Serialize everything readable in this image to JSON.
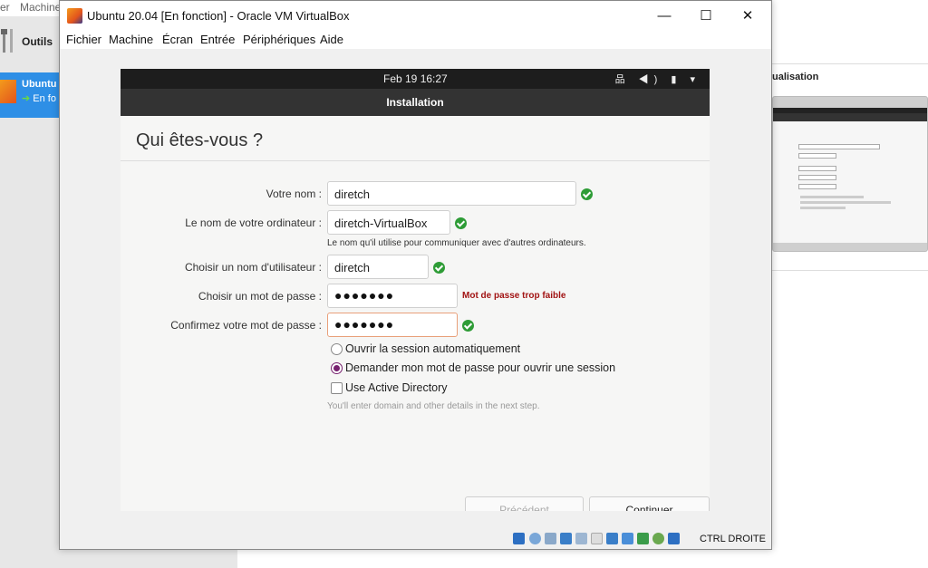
{
  "background": {
    "menu": [
      "er",
      "Machine"
    ],
    "tools_label": "Outils",
    "vm_item": {
      "name": "Ubuntu",
      "state": "En fo"
    },
    "preview_title": "ualisation"
  },
  "window": {
    "title": "Ubuntu 20.04 [En fonction] - Oracle VM VirtualBox",
    "minimize": "—",
    "maximize": "☐",
    "close": "✕",
    "menu": [
      "Fichier",
      "Machine",
      "Écran",
      "Entrée",
      "Périphériques",
      "Aide"
    ]
  },
  "ubuntu": {
    "clock": "Feb 19  16:27",
    "tray": "品 ◀) ▮ ▾",
    "header": "Installation",
    "heading": "Qui êtes-vous ?",
    "form": {
      "name_label": "Votre nom :",
      "name_value": "diretch",
      "computer_label": "Le nom de votre ordinateur :",
      "computer_value": "diretch-VirtualBox",
      "computer_hint": "Le nom qu'il utilise pour communiquer avec d'autres ordinateurs.",
      "username_label": "Choisir un nom d'utilisateur :",
      "username_value": "diretch",
      "password_label": "Choisir un mot de passe :",
      "password_value": "●●●●●●●",
      "password_strength": "Mot de passe trop faible",
      "confirm_label": "Confirmez votre mot de passe :",
      "confirm_value": "●●●●●●●"
    },
    "options": {
      "auto_login": "Ouvrir la session automatiquement",
      "require_password": "Demander mon mot de passe pour ouvrir une session",
      "active_directory": "Use Active Directory",
      "ad_hint": "You'll enter domain and other details in the next step."
    },
    "buttons": {
      "back": "Précédent",
      "continue": "Continuer"
    }
  },
  "statusbar": {
    "host_key": "CTRL DROITE"
  },
  "colors": {
    "ubuntu_accent": "#77216f",
    "ok_green": "#2e9c36",
    "weak_red": "#a11313"
  }
}
